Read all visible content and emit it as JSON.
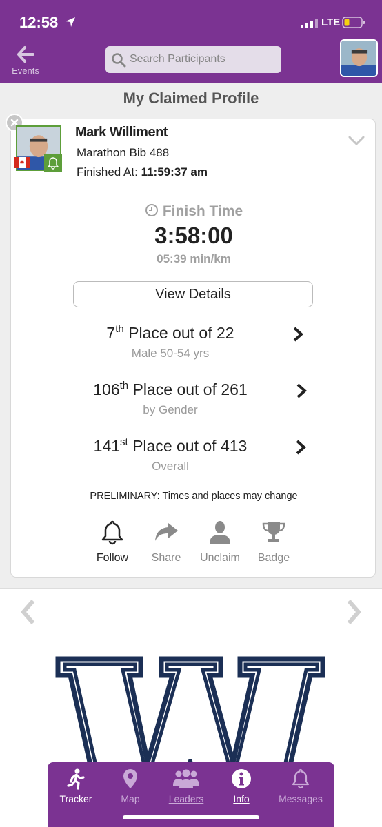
{
  "status_bar": {
    "time": "12:58",
    "network": "LTE"
  },
  "header": {
    "back_label": "Events",
    "search_placeholder": "Search Participants"
  },
  "section_title": "My Claimed Profile",
  "profile": {
    "name": "Mark Williment",
    "bib": "Marathon Bib 488",
    "finished_label": "Finished At:",
    "finished_value": "11:59:37 am",
    "country_flag": "canada"
  },
  "finish": {
    "label": "Finish Time",
    "time": "3:58:00",
    "pace": "05:39 min/km"
  },
  "view_details_label": "View Details",
  "places": [
    {
      "num": "7",
      "suffix": "th",
      "rest": " Place out of 22",
      "sub": "Male 50-54 yrs"
    },
    {
      "num": "106",
      "suffix": "th",
      "rest": " Place out of 261",
      "sub": "by Gender"
    },
    {
      "num": "141",
      "suffix": "st",
      "rest": " Place out of 413",
      "sub": "Overall"
    }
  ],
  "preliminary_note": "PRELIMINARY: Times and places may change",
  "actions": [
    {
      "label": "Follow",
      "icon": "bell-icon",
      "active": true
    },
    {
      "label": "Share",
      "icon": "share-arrow-icon",
      "active": false
    },
    {
      "label": "Unclaim",
      "icon": "person-icon",
      "active": false
    },
    {
      "label": "Badge",
      "icon": "trophy-icon",
      "active": false
    }
  ],
  "tabs": [
    {
      "label": "Tracker",
      "icon": "runner-icon",
      "active": true
    },
    {
      "label": "Map",
      "icon": "map-pin-icon",
      "active": false
    },
    {
      "label": "Leaders",
      "icon": "group-icon",
      "active": false
    },
    {
      "label": "Info",
      "icon": "info-icon",
      "active": false
    },
    {
      "label": "Messages",
      "icon": "bell-icon",
      "active": false
    }
  ],
  "colors": {
    "brand_purple": "#7b3392",
    "avatar_border_green": "#5d9e3a",
    "logo_navy": "#1b2f55"
  }
}
